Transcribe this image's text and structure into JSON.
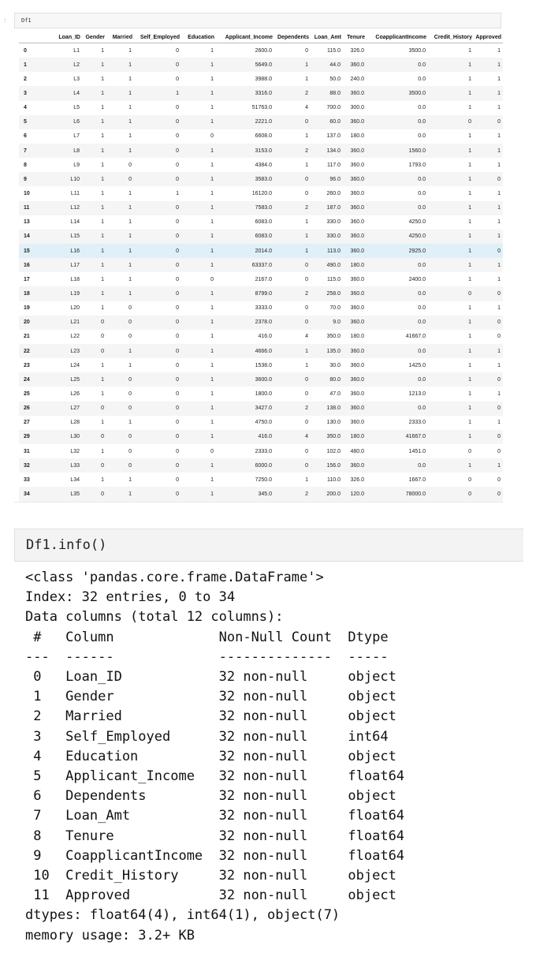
{
  "cell1": {
    "code": "Df1",
    "columns": [
      "",
      "Loan_ID",
      "Gender",
      "Married",
      "Self_Employed",
      "Education",
      "Applicant_Income",
      "Dependents",
      "Loan_Amt",
      "Tenure",
      "CoapplicantIncome",
      "Credit_History",
      "Approved"
    ],
    "rows": [
      [
        "0",
        "L1",
        "1",
        "1",
        "0",
        "1",
        "2600.0",
        "0",
        "115.0",
        "326.0",
        "3500.0",
        "1",
        "1"
      ],
      [
        "1",
        "L2",
        "1",
        "1",
        "0",
        "1",
        "5649.0",
        "1",
        "44.0",
        "360.0",
        "0.0",
        "1",
        "1"
      ],
      [
        "2",
        "L3",
        "1",
        "1",
        "0",
        "1",
        "3988.0",
        "1",
        "50.0",
        "240.0",
        "0.0",
        "1",
        "1"
      ],
      [
        "3",
        "L4",
        "1",
        "1",
        "1",
        "1",
        "3316.0",
        "2",
        "88.0",
        "360.0",
        "3500.0",
        "1",
        "1"
      ],
      [
        "4",
        "L5",
        "1",
        "1",
        "0",
        "1",
        "51763.0",
        "4",
        "700.0",
        "300.0",
        "0.0",
        "1",
        "1"
      ],
      [
        "5",
        "L6",
        "1",
        "1",
        "0",
        "1",
        "2221.0",
        "0",
        "60.0",
        "360.0",
        "0.0",
        "0",
        "0"
      ],
      [
        "6",
        "L7",
        "1",
        "1",
        "0",
        "0",
        "6608.0",
        "1",
        "137.0",
        "180.0",
        "0.0",
        "1",
        "1"
      ],
      [
        "7",
        "L8",
        "1",
        "1",
        "0",
        "1",
        "3153.0",
        "2",
        "134.0",
        "360.0",
        "1560.0",
        "1",
        "1"
      ],
      [
        "8",
        "L9",
        "1",
        "0",
        "0",
        "1",
        "4384.0",
        "1",
        "117.0",
        "360.0",
        "1793.0",
        "1",
        "1"
      ],
      [
        "9",
        "L10",
        "1",
        "0",
        "0",
        "1",
        "3583.0",
        "0",
        "96.0",
        "360.0",
        "0.0",
        "1",
        "0"
      ],
      [
        "10",
        "L11",
        "1",
        "1",
        "1",
        "1",
        "16120.0",
        "0",
        "260.0",
        "360.0",
        "0.0",
        "1",
        "1"
      ],
      [
        "11",
        "L12",
        "1",
        "1",
        "0",
        "1",
        "7583.0",
        "2",
        "187.0",
        "360.0",
        "0.0",
        "1",
        "1"
      ],
      [
        "13",
        "L14",
        "1",
        "1",
        "0",
        "1",
        "6083.0",
        "1",
        "330.0",
        "360.0",
        "4250.0",
        "1",
        "1"
      ],
      [
        "14",
        "L15",
        "1",
        "1",
        "0",
        "1",
        "6083.0",
        "1",
        "330.0",
        "360.0",
        "4250.0",
        "1",
        "1"
      ],
      [
        "15",
        "L16",
        "1",
        "1",
        "0",
        "1",
        "2014.0",
        "1",
        "113.0",
        "360.0",
        "2925.0",
        "1",
        "0"
      ],
      [
        "16",
        "L17",
        "1",
        "1",
        "0",
        "1",
        "63337.0",
        "0",
        "490.0",
        "180.0",
        "0.0",
        "1",
        "1"
      ],
      [
        "17",
        "L18",
        "1",
        "1",
        "0",
        "0",
        "2167.0",
        "0",
        "115.0",
        "360.0",
        "2400.0",
        "1",
        "1"
      ],
      [
        "18",
        "L19",
        "1",
        "1",
        "0",
        "1",
        "8799.0",
        "2",
        "258.0",
        "360.0",
        "0.0",
        "0",
        "0"
      ],
      [
        "19",
        "L20",
        "1",
        "0",
        "0",
        "1",
        "3333.0",
        "0",
        "70.0",
        "360.0",
        "0.0",
        "1",
        "1"
      ],
      [
        "20",
        "L21",
        "0",
        "0",
        "0",
        "1",
        "2378.0",
        "0",
        "9.0",
        "360.0",
        "0.0",
        "1",
        "0"
      ],
      [
        "21",
        "L22",
        "0",
        "0",
        "0",
        "1",
        "416.0",
        "4",
        "350.0",
        "180.0",
        "41667.0",
        "1",
        "0"
      ],
      [
        "22",
        "L23",
        "0",
        "1",
        "0",
        "1",
        "4666.0",
        "1",
        "135.0",
        "360.0",
        "0.0",
        "1",
        "1"
      ],
      [
        "23",
        "L24",
        "1",
        "1",
        "0",
        "1",
        "1538.0",
        "1",
        "30.0",
        "360.0",
        "1425.0",
        "1",
        "1"
      ],
      [
        "24",
        "L25",
        "1",
        "0",
        "0",
        "1",
        "3600.0",
        "0",
        "80.0",
        "360.0",
        "0.0",
        "1",
        "0"
      ],
      [
        "25",
        "L26",
        "1",
        "0",
        "0",
        "1",
        "1800.0",
        "0",
        "47.0",
        "360.0",
        "1213.0",
        "1",
        "1"
      ],
      [
        "26",
        "L27",
        "0",
        "0",
        "0",
        "1",
        "3427.0",
        "2",
        "138.0",
        "360.0",
        "0.0",
        "1",
        "0"
      ],
      [
        "27",
        "L28",
        "1",
        "1",
        "0",
        "1",
        "4750.0",
        "0",
        "130.0",
        "360.0",
        "2333.0",
        "1",
        "1"
      ],
      [
        "29",
        "L30",
        "0",
        "0",
        "0",
        "1",
        "416.0",
        "4",
        "350.0",
        "180.0",
        "41667.0",
        "1",
        "0"
      ],
      [
        "31",
        "L32",
        "1",
        "0",
        "0",
        "0",
        "2333.0",
        "0",
        "102.0",
        "480.0",
        "1451.0",
        "0",
        "0"
      ],
      [
        "32",
        "L33",
        "0",
        "0",
        "0",
        "1",
        "6000.0",
        "0",
        "156.0",
        "360.0",
        "0.0",
        "1",
        "1"
      ],
      [
        "33",
        "L34",
        "1",
        "1",
        "0",
        "1",
        "7250.0",
        "1",
        "110.0",
        "326.0",
        "1667.0",
        "0",
        "0"
      ],
      [
        "34",
        "L35",
        "0",
        "1",
        "0",
        "1",
        "345.0",
        "2",
        "200.0",
        "120.0",
        "78000.0",
        "0",
        "0"
      ]
    ]
  },
  "cell2": {
    "code": "Df1.info()",
    "output": "<class 'pandas.core.frame.DataFrame'>\nIndex: 32 entries, 0 to 34\nData columns (total 12 columns):\n #   Column             Non-Null Count  Dtype  \n---  ------             --------------  -----  \n 0   Loan_ID            32 non-null     object \n 1   Gender             32 non-null     object \n 2   Married            32 non-null     object \n 3   Self_Employed      32 non-null     int64  \n 4   Education          32 non-null     object \n 5   Applicant_Income   32 non-null     float64\n 6   Dependents         32 non-null     object \n 7   Loan_Amt           32 non-null     float64\n 8   Tenure             32 non-null     float64\n 9   CoapplicantIncome  32 non-null     float64\n 10  Credit_History     32 non-null     object \n 11  Approved           32 non-null     object \ndtypes: float64(4), int64(1), object(7)\nmemory usage: 3.2+ KB"
  },
  "highlight_row": 14
}
